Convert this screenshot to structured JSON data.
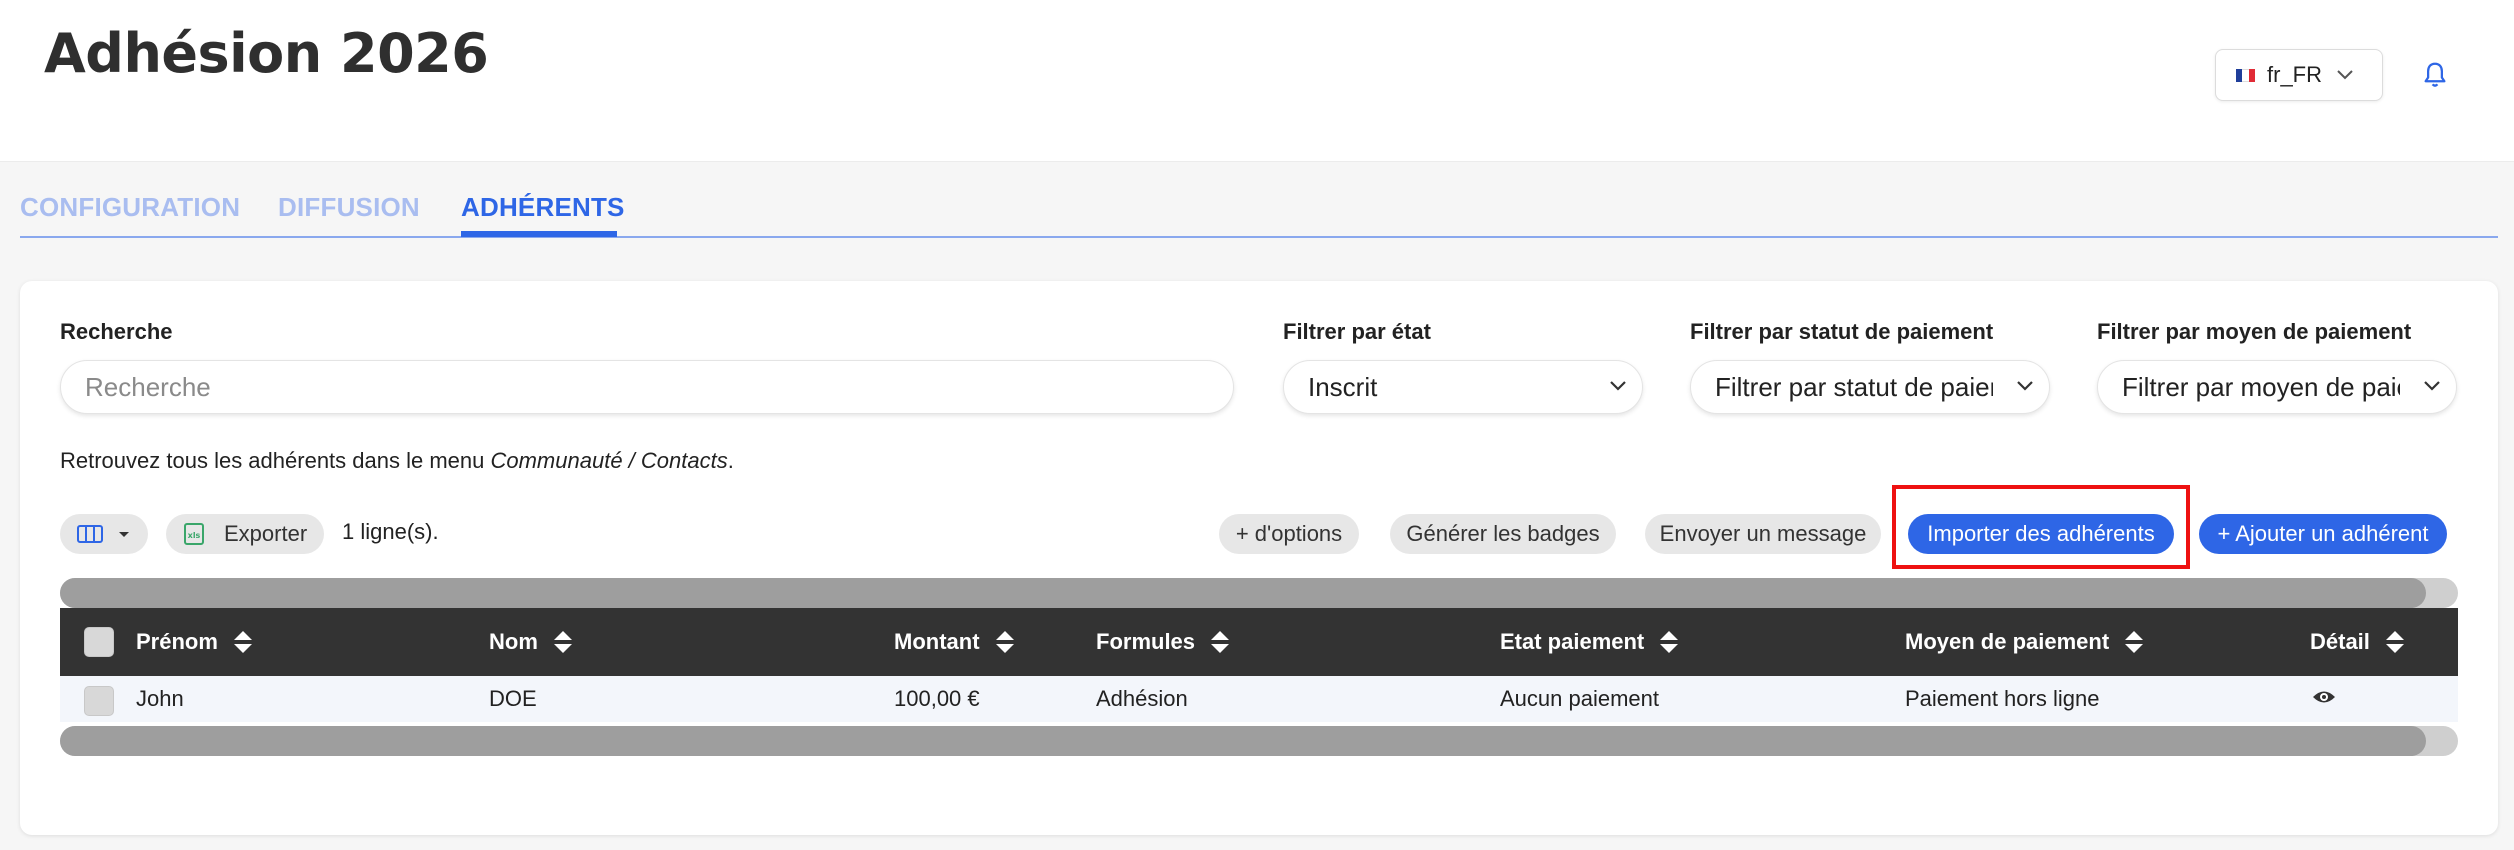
{
  "header": {
    "title": "Adhésion 2026",
    "language": "fr_FR"
  },
  "tabs": [
    "CONFIGURATION",
    "DIFFUSION",
    "ADHÉRENTS"
  ],
  "filters": {
    "search_label": "Recherche",
    "search_placeholder": "Recherche",
    "state_label": "Filtrer par état",
    "state_value": "Inscrit",
    "payment_status_label": "Filtrer par statut de paiement",
    "payment_status_value": "Filtrer par statut de paiement",
    "payment_method_label": "Filtrer par moyen de paiement",
    "payment_method_value": "Filtrer par moyen de paiement"
  },
  "info": {
    "prefix": "Retrouvez tous les adhérents dans le menu ",
    "link": "Communauté / Contacts",
    "suffix": "."
  },
  "toolbar": {
    "export_label": "Exporter",
    "row_count": "1 ligne(s).",
    "more_options": "+ d'options",
    "badges": "Générer les badges",
    "message": "Envoyer un message",
    "import": "Importer des adhérents",
    "add": "+ Ajouter un adhérent"
  },
  "table": {
    "columns": [
      "Prénom",
      "Nom",
      "Montant",
      "Formules",
      "Etat paiement",
      "Moyen de paiement",
      "Détail"
    ],
    "rows": [
      [
        "John",
        "DOE",
        "100,00 €",
        "Adhésion",
        "Aucun paiement",
        "Paiement hors ligne"
      ]
    ]
  },
  "colors": {
    "accent": "#2e66e6",
    "accent_light": "#a9bdf0",
    "table_header": "#333333",
    "highlight": "#ee1111"
  },
  "icons": [
    "france-flag-icon",
    "chevron-down-icon",
    "bell-icon",
    "columns-icon",
    "excel-icon",
    "sort-icon",
    "eye-icon"
  ]
}
